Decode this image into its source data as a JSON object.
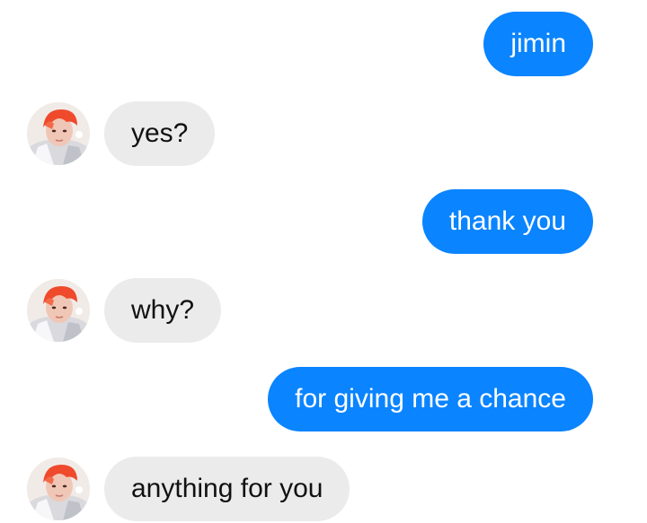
{
  "conversation": {
    "messages": [
      {
        "sender": "me",
        "text": "jimin"
      },
      {
        "sender": "contact",
        "text": "yes?",
        "avatar_icon": "contact-avatar"
      },
      {
        "sender": "me",
        "text": "thank you"
      },
      {
        "sender": "contact",
        "text": "why?",
        "avatar_icon": "contact-avatar"
      },
      {
        "sender": "me",
        "text": "for giving me a chance"
      },
      {
        "sender": "contact",
        "text": "anything for you",
        "avatar_icon": "contact-avatar"
      }
    ]
  },
  "colors": {
    "outgoing_bubble": "#0a84ff",
    "incoming_bubble": "#ebebeb",
    "outgoing_text": "#ffffff",
    "incoming_text": "#111111",
    "background": "#ffffff"
  }
}
